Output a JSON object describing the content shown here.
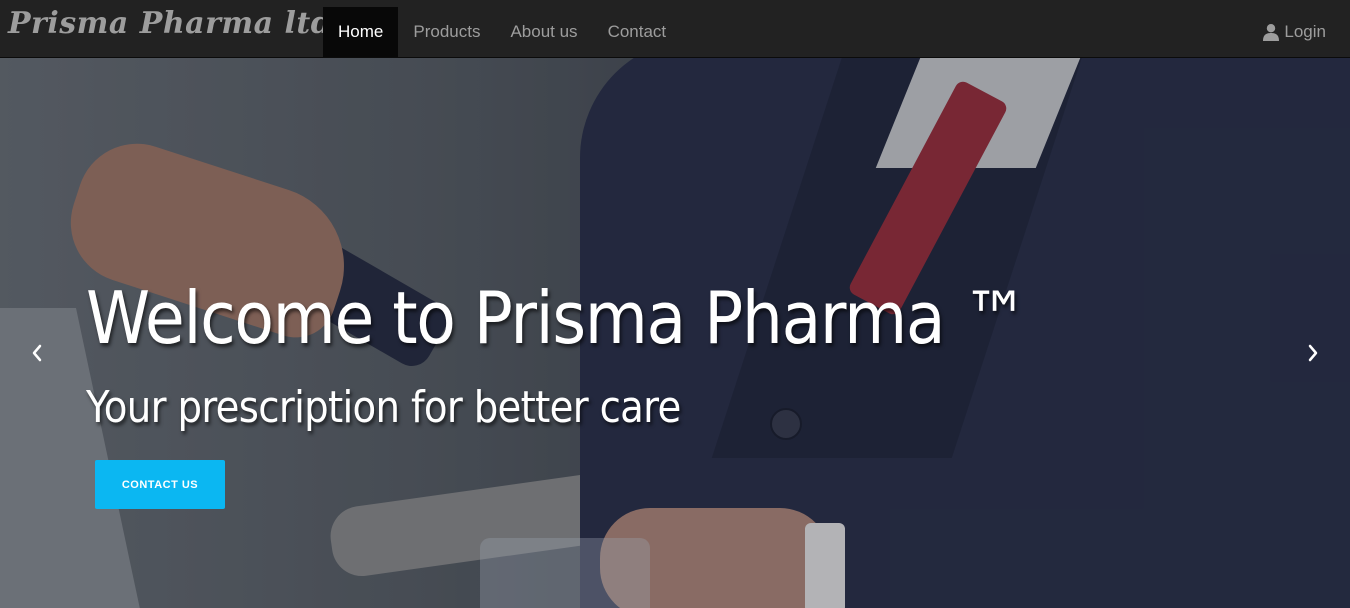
{
  "navbar": {
    "brand": "Prisma Pharma ltd.",
    "links": [
      {
        "label": "Home",
        "active": true
      },
      {
        "label": "Products",
        "active": false
      },
      {
        "label": "About us",
        "active": false
      },
      {
        "label": "Contact",
        "active": false
      }
    ],
    "login_label": "Login",
    "login_icon": "user-icon"
  },
  "hero": {
    "title": "Welcome to Prisma Pharma ™",
    "subtitle": "Your prescription for better care",
    "cta_label": "CONTACT US",
    "cta_color": "#0bb7f2",
    "prev_icon": "chevron-left-icon",
    "next_icon": "chevron-right-icon"
  },
  "colors": {
    "navbar_bg": "#222222",
    "nav_text": "#9d9d9d",
    "nav_active_bg": "#080808",
    "nav_active_text": "#ffffff"
  }
}
